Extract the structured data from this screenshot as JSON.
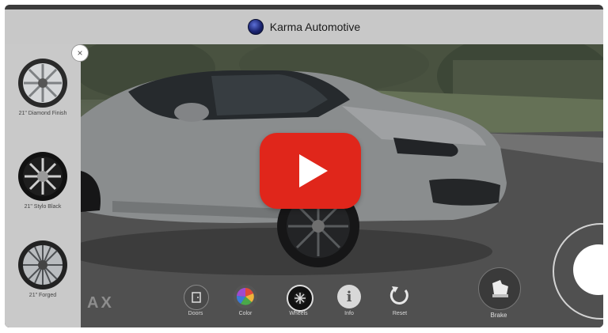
{
  "header": {
    "title": "Karma Automotive",
    "logo_icon": "karma-logo-icon"
  },
  "sidebar": {
    "close_label": "×",
    "wheels": [
      {
        "label": "21\" Diamond Finish",
        "style": "silver"
      },
      {
        "label": "21\" Stylo Black",
        "style": "black"
      },
      {
        "label": "21\" Forged",
        "style": "chrome"
      }
    ]
  },
  "watermark": {
    "text": "AX"
  },
  "video": {
    "play_icon": "play-icon",
    "accent": "#e0261b"
  },
  "toolbar": {
    "items": [
      {
        "label": "Doors",
        "icon": "door-icon"
      },
      {
        "label": "Color",
        "icon": "color-palette-icon"
      },
      {
        "label": "Wheels",
        "icon": "wheel-icon"
      },
      {
        "label": "Info",
        "icon": "info-icon"
      },
      {
        "label": "Reset",
        "icon": "reset-icon"
      }
    ],
    "brake_label": "Brake"
  }
}
